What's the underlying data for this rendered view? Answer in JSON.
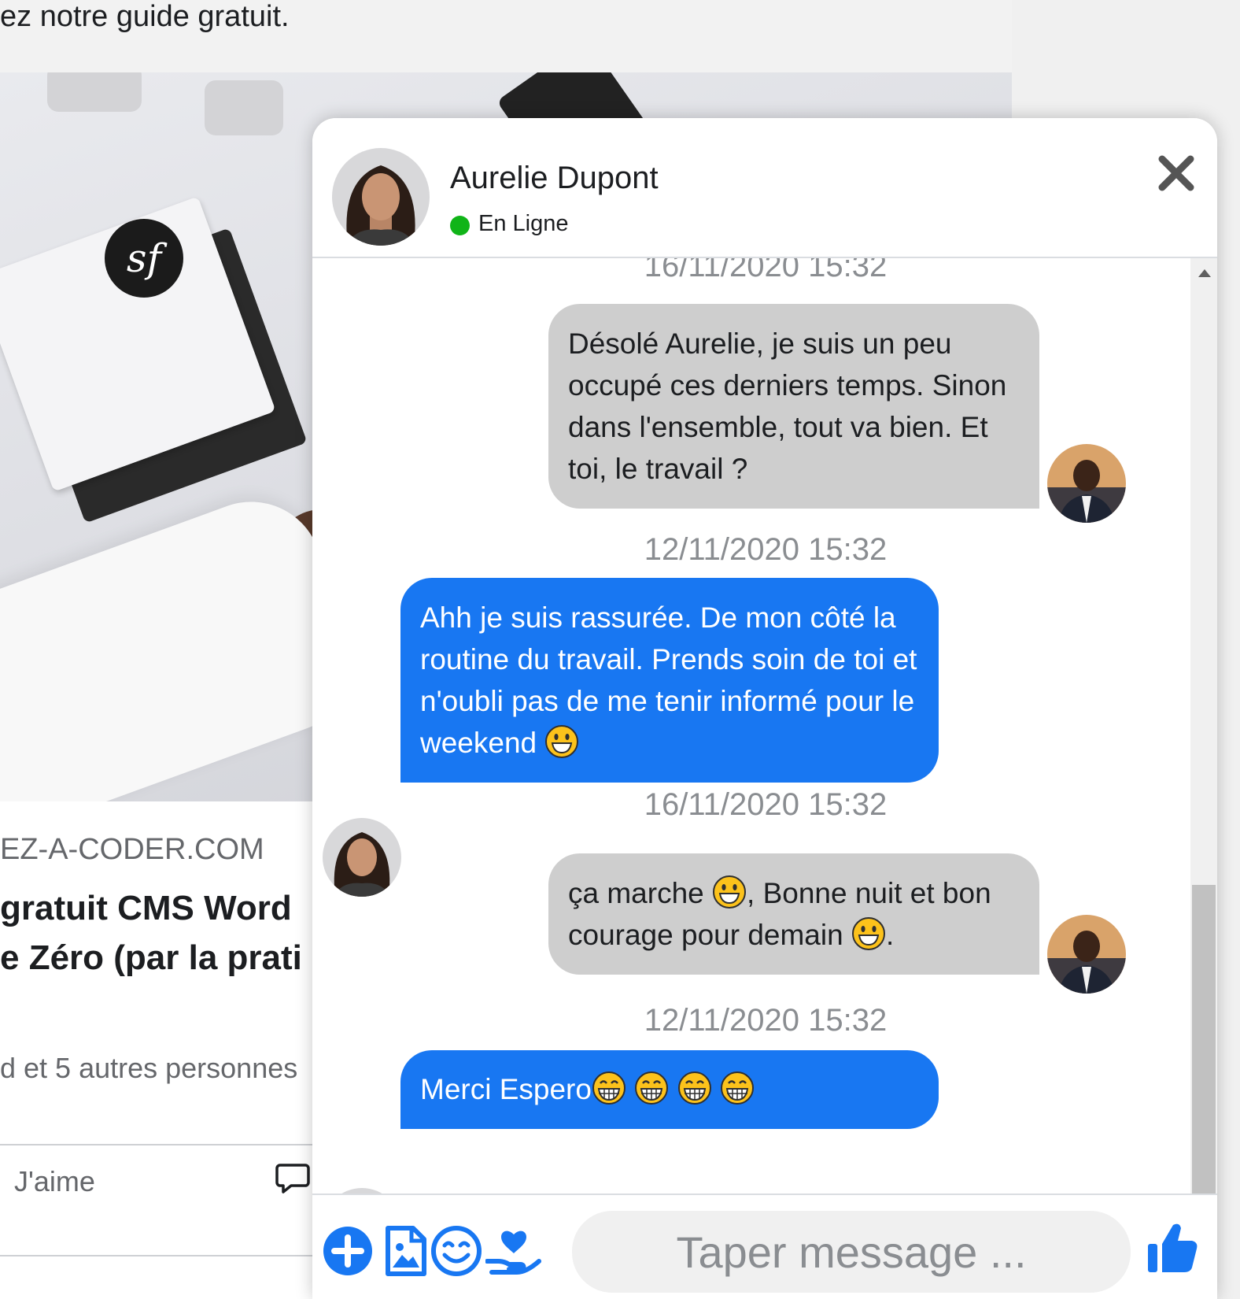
{
  "feed": {
    "intro_text": "ez notre guide gratuit.",
    "domain": "EZ-A-CODER.COM",
    "title_lines": "gratuit CMS Word\ne Zéro (par la prati",
    "likes_text": "d et 5 autres personnes",
    "like_label": "J'aime"
  },
  "chat": {
    "contact_name": "Aurelie Dupont",
    "status": "En Ligne",
    "status_color": "#10b418",
    "accent_color": "#1877f2",
    "input_placeholder": "Taper message ...",
    "timestamps": {
      "t0": "16/11/2020 15:32",
      "t1": "12/11/2020 15:32",
      "t2": "16/11/2020 15:32",
      "t3": "12/11/2020 15:32"
    },
    "messages": {
      "m1": {
        "from": "me",
        "text": "Désolé Aurelie, je suis un peu occupé ces derniers temps. Sinon dans l'ensemble, tout va bien. Et toi, le travail ?"
      },
      "m2": {
        "from": "contact",
        "text": "Ahh je suis rassurée. De mon côté la routine du travail. Prends soin de toi et n'oubli pas de me tenir informé pour le weekend",
        "emoji": "grinning"
      },
      "m3": {
        "from": "me",
        "text_a": "ça marche",
        "emoji_a": "grinning",
        "text_b": ", Bonne nuit et bon courage pour demain",
        "emoji_b": "grinning",
        "text_c": "."
      },
      "m4": {
        "from": "contact",
        "text": "Merci Espero",
        "emojis": [
          "beaming",
          "beaming",
          "beaming",
          "beaming"
        ]
      }
    },
    "footer_icons": [
      "plus-circle-icon",
      "image-file-icon",
      "smiley-icon",
      "heart-hand-icon",
      "thumbs-up-icon"
    ]
  }
}
